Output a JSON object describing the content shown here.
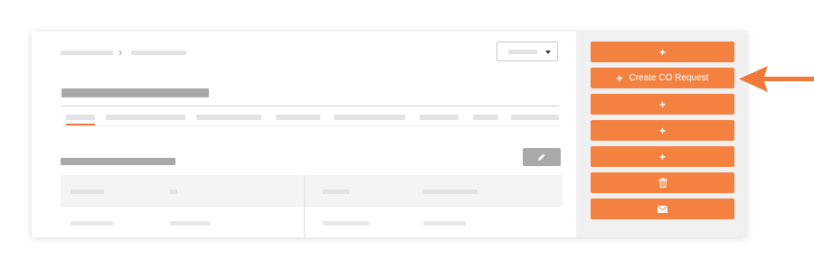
{
  "breadcrumb": {
    "separator": "›"
  },
  "sidebar": {
    "buttons": [
      {
        "name": "add-button-1",
        "icon": "plus-icon",
        "glyph": "+",
        "label": ""
      },
      {
        "name": "create-co-request-button",
        "icon": "plus-icon",
        "glyph": "+",
        "label": "Create CO Request"
      },
      {
        "name": "add-button-2",
        "icon": "plus-icon",
        "glyph": "+",
        "label": ""
      },
      {
        "name": "add-button-3",
        "icon": "plus-icon",
        "glyph": "+",
        "label": ""
      },
      {
        "name": "add-button-4",
        "icon": "plus-icon",
        "glyph": "+",
        "label": ""
      },
      {
        "name": "delete-button",
        "icon": "trash-icon",
        "glyph": "",
        "label": ""
      },
      {
        "name": "email-button",
        "icon": "envelope-icon",
        "glyph": "",
        "label": ""
      }
    ]
  },
  "colors": {
    "accent": "#f38241",
    "arrow": "#f07a3a",
    "placeholder_dark": "#a9a9a9",
    "placeholder_light": "#e3e3e3"
  }
}
